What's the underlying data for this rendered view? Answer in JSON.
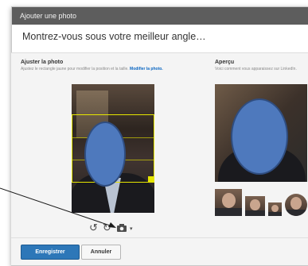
{
  "dialog": {
    "title": "Ajouter une photo",
    "heading": "Montrez-vous sous votre meilleur angle…"
  },
  "adjust": {
    "label": "Ajuster la photo",
    "description": "Ajustez le rectangle jaune pour modifier la position et la taille.",
    "link": "Modifier la photo."
  },
  "preview": {
    "label": "Aperçu",
    "description": "Voici comment vous apparaissez sur LinkedIn."
  },
  "icons": {
    "rotate_left": "rotate-left-icon",
    "rotate_right": "rotate-right-icon",
    "camera": "camera-icon",
    "dropdown": "chevron-down-icon"
  },
  "footer": {
    "save_label": "Enregistrer",
    "cancel_label": "Annuler"
  },
  "colors": {
    "titlebar": "#5d5d5d",
    "primary_button": "#2d77b8",
    "link": "#0a66c2",
    "crop_frame": "#e6e600",
    "face_mask": "#4e79bd"
  }
}
